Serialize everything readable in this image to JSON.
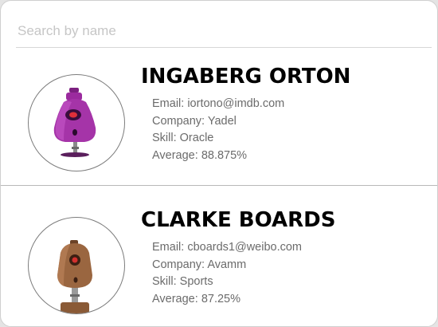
{
  "search": {
    "placeholder": "Search by name",
    "value": ""
  },
  "students": [
    {
      "name": "INGABERG ORTON",
      "email_label": "Email:",
      "email": "iortono@imdb.com",
      "company_label": "Company:",
      "company": "Yadel",
      "skill_label": "Skill:",
      "skill": "Oracle",
      "average_label": "Average:",
      "average": "88.875%",
      "avatar_icon": "purple-robot-icon",
      "avatar_color": "#9b2a9e"
    },
    {
      "name": "CLARKE BOARDS",
      "email_label": "Email:",
      "email": "cboards1@weibo.com",
      "company_label": "Company:",
      "company": "Avamm",
      "skill_label": "Skill:",
      "skill": "Sports",
      "average_label": "Average:",
      "average": "87.25%",
      "avatar_icon": "brown-robot-icon",
      "avatar_color": "#8a5a36"
    }
  ]
}
